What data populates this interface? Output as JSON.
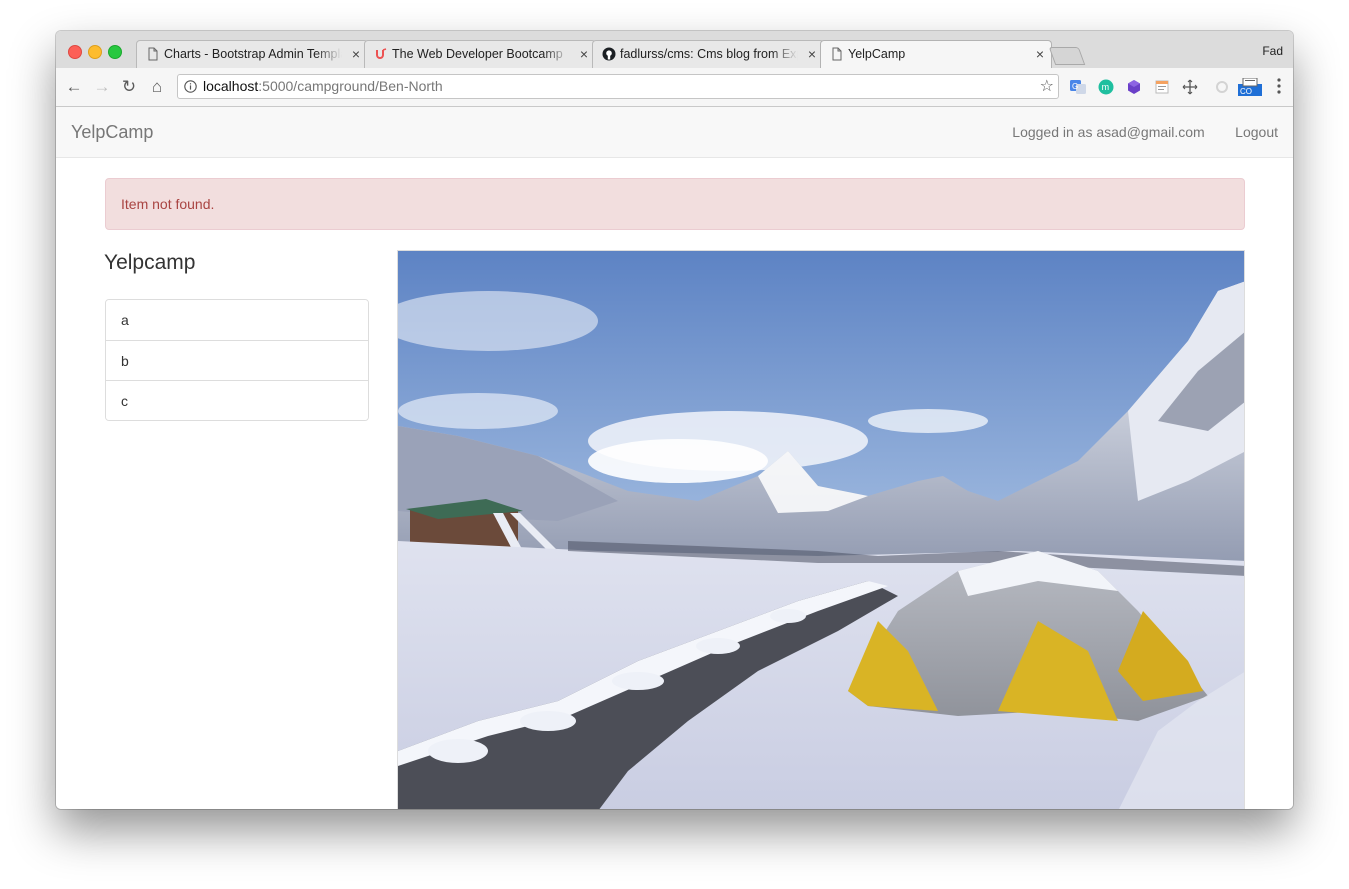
{
  "browser": {
    "tabs": [
      {
        "title": "Charts - Bootstrap Admin Template",
        "favicon": "document-icon",
        "active": false
      },
      {
        "title": "The Web Developer Bootcamp",
        "favicon": "udemy-icon",
        "active": false
      },
      {
        "title": "fadlurss/cms: Cms blog from Express",
        "favicon": "github-icon",
        "active": false
      },
      {
        "title": "YelpCamp",
        "favicon": "document-icon",
        "active": true
      }
    ],
    "close_glyph": "×",
    "profile_name": "Fad",
    "url_host": "localhost",
    "url_path": ":5000/campground/Ben-North",
    "nav": {
      "back": "←",
      "forward": "→",
      "reload": "↻",
      "home": "⌂"
    },
    "star_glyph": "☆"
  },
  "navbar": {
    "brand": "YelpCamp",
    "user_label": "Logged in as asad@gmail.com",
    "logout_label": "Logout"
  },
  "alert": {
    "message": "Item not found.",
    "type": "danger"
  },
  "sidebar": {
    "title": "Yelpcamp",
    "items": [
      {
        "label": "a"
      },
      {
        "label": "b"
      },
      {
        "label": "c"
      }
    ]
  },
  "image": {
    "subject": "tent in snowy mountain campground"
  },
  "colors": {
    "alert_bg": "#f2dede",
    "alert_text": "#a94442",
    "navbar_bg": "#f8f8f8"
  }
}
